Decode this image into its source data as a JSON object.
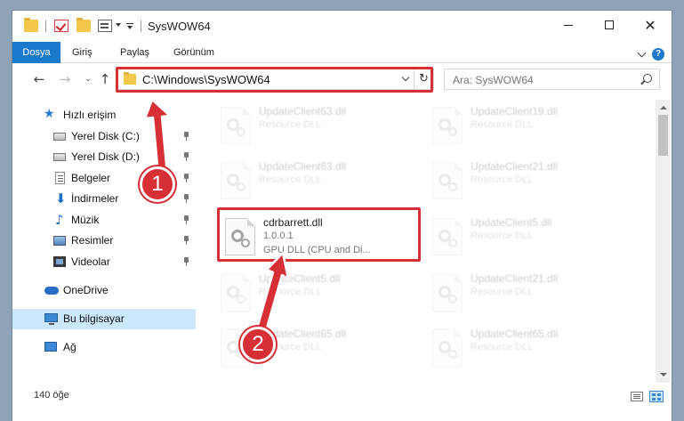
{
  "window": {
    "title": "SysWOW64",
    "controls": {
      "minimize": "—",
      "maximize": "□",
      "close": "✕"
    }
  },
  "ribbon": {
    "tabs": [
      "Dosya",
      "Giriş",
      "Paylaş",
      "Görünüm"
    ],
    "help": "?"
  },
  "navigation": {
    "back": "←",
    "forward": "→",
    "recent": "⌄",
    "up": "↑",
    "address": "C:\\Windows\\SysWOW64",
    "refresh": "↻",
    "search_placeholder": "Ara: SysWOW64"
  },
  "sidebar": {
    "items": [
      {
        "label": "Hızlı erişim",
        "icon": "star-icon"
      },
      {
        "label": "Yerel Disk (C:)",
        "icon": "disk-icon",
        "pinned": true
      },
      {
        "label": "Yerel Disk (D:)",
        "icon": "disk-icon",
        "pinned": true
      },
      {
        "label": "Belgeler",
        "icon": "document-icon",
        "pinned": true
      },
      {
        "label": "İndirmeler",
        "icon": "download-icon",
        "pinned": true
      },
      {
        "label": "Müzik",
        "icon": "music-icon",
        "pinned": true
      },
      {
        "label": "Resimler",
        "icon": "pictures-icon",
        "pinned": true
      },
      {
        "label": "Videolar",
        "icon": "video-icon",
        "pinned": true
      },
      {
        "label": "OneDrive",
        "icon": "cloud-icon"
      },
      {
        "label": "Bu bilgisayar",
        "icon": "computer-icon",
        "selected": true
      },
      {
        "label": "Ağ",
        "icon": "network-icon"
      }
    ]
  },
  "files": {
    "left_column": [
      {
        "name": "UpdateClient63.dll",
        "desc": "Resource DLL"
      },
      {
        "name": "UpdateClient63.dll",
        "desc": "Resource DLL"
      },
      {
        "name": "cdrbarrett.dll",
        "version": "1.0.0.1",
        "desc": "GPU DLL (CPU and Di...",
        "highlighted": true
      },
      {
        "name": "UpdateClient5.dll",
        "desc": "Resource DLL"
      },
      {
        "name": "UpdateClient65.dll",
        "desc": "Resource DLL"
      }
    ],
    "right_column": [
      {
        "name": "UpdateClient19.dll",
        "desc": "Resource DLL"
      },
      {
        "name": "UpdateClient21.dll",
        "desc": "Resource DLL"
      },
      {
        "name": "UpdateClient5.dll",
        "desc": "Resource DLL"
      },
      {
        "name": "UpdateClient21.dll",
        "desc": "Resource DLL"
      },
      {
        "name": "UpdateClient65.dll",
        "desc": "Resource DLL"
      }
    ]
  },
  "status": {
    "item_count": "140 öğe"
  },
  "annotations": {
    "step1": "1",
    "step2": "2",
    "color": "#d62f36"
  }
}
